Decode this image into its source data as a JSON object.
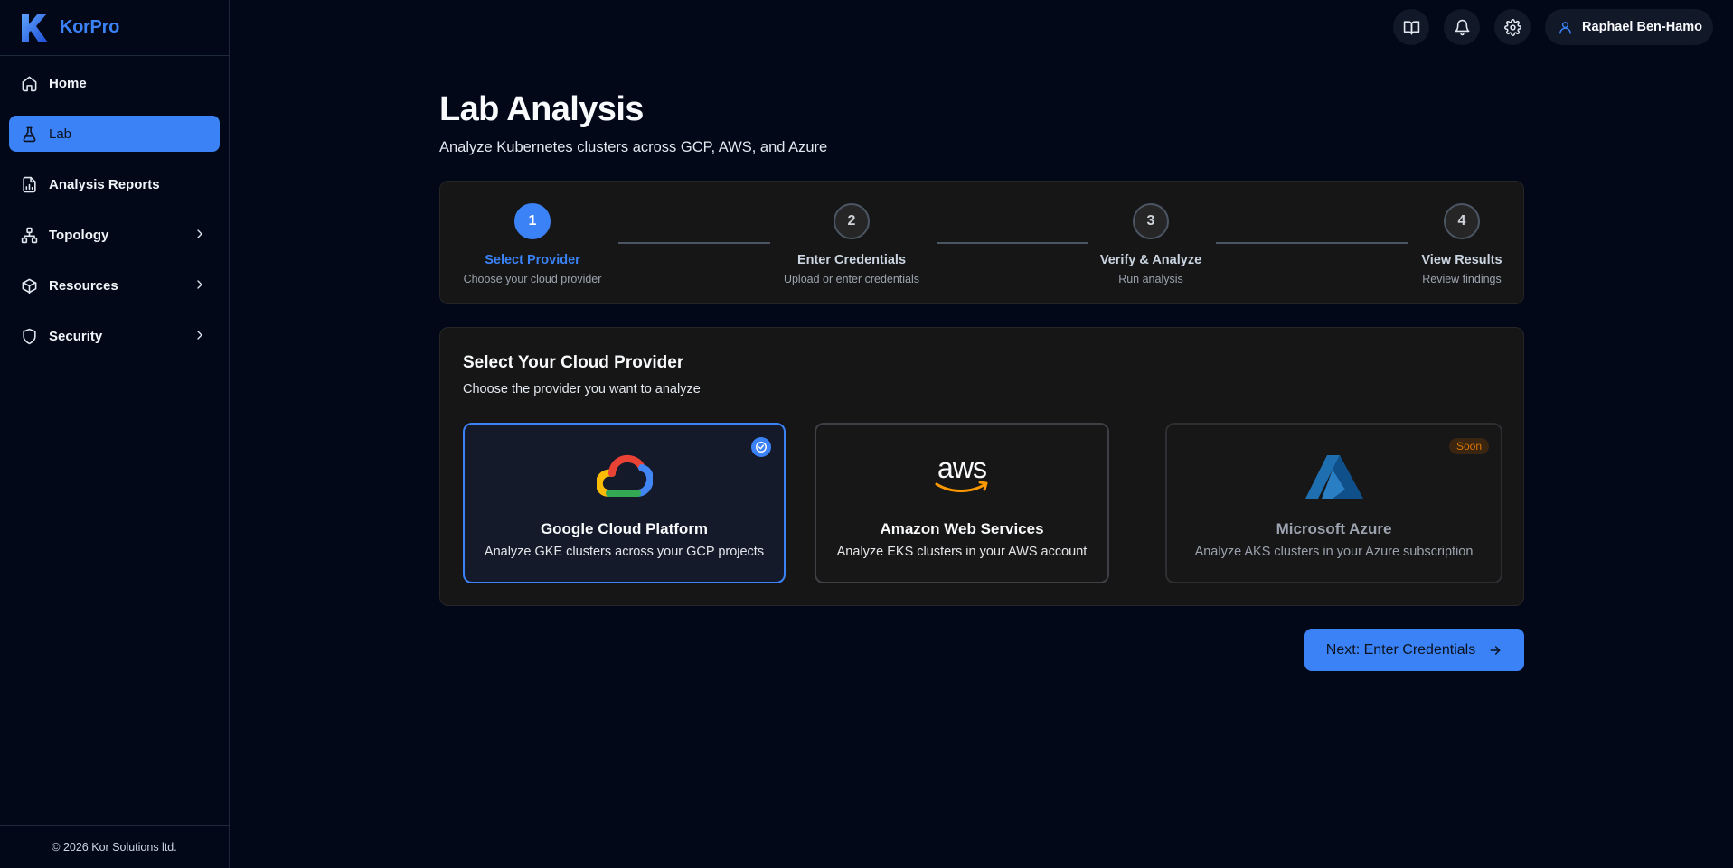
{
  "app": {
    "name": "KorPro",
    "footer": "© 2026 Kor Solutions ltd."
  },
  "sidebar": {
    "items": [
      {
        "label": "Home",
        "icon": "home-icon",
        "active": false,
        "chevron": false
      },
      {
        "label": "Lab",
        "icon": "flask-icon",
        "active": true,
        "chevron": false
      },
      {
        "label": "Analysis Reports",
        "icon": "report-icon",
        "active": false,
        "chevron": false
      },
      {
        "label": "Topology",
        "icon": "topology-icon",
        "active": false,
        "chevron": true
      },
      {
        "label": "Resources",
        "icon": "cube-icon",
        "active": false,
        "chevron": true
      },
      {
        "label": "Security",
        "icon": "shield-icon",
        "active": false,
        "chevron": true
      }
    ]
  },
  "header": {
    "icons": [
      "book-icon",
      "bell-icon",
      "gear-icon"
    ],
    "user": "Raphael Ben-Hamo"
  },
  "page": {
    "title": "Lab Analysis",
    "subtitle": "Analyze Kubernetes clusters across GCP, AWS, and Azure"
  },
  "steps": [
    {
      "number": "1",
      "label": "Select Provider",
      "desc": "Choose your cloud provider",
      "active": true
    },
    {
      "number": "2",
      "label": "Enter Credentials",
      "desc": "Upload or enter credentials",
      "active": false
    },
    {
      "number": "3",
      "label": "Verify & Analyze",
      "desc": "Run analysis",
      "active": false
    },
    {
      "number": "4",
      "label": "View Results",
      "desc": "Review findings",
      "active": false
    }
  ],
  "provider_panel": {
    "title": "Select Your Cloud Provider",
    "subtitle": "Choose the provider you want to analyze",
    "providers": [
      {
        "name": "Google Cloud Platform",
        "desc": "Analyze GKE clusters across your GCP projects",
        "selected": true
      },
      {
        "name": "Amazon Web Services",
        "desc": "Analyze EKS clusters in your AWS account",
        "selected": false
      },
      {
        "name": "Microsoft Azure",
        "desc": "Analyze AKS clusters in your Azure subscription",
        "selected": false,
        "badge": "Soon"
      }
    ]
  },
  "next_button": {
    "label": "Next: Enter Credentials"
  },
  "colors": {
    "accent": "#3b82f6",
    "background": "#020817",
    "panel": "#161616",
    "soon": "#d97706"
  }
}
